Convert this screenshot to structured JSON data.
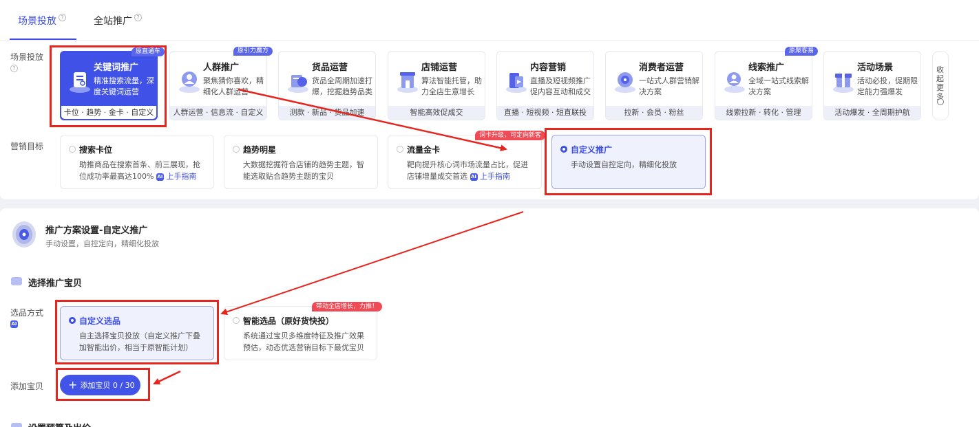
{
  "tabs": [
    {
      "label": "场景投放",
      "active": true
    },
    {
      "label": "全站推广",
      "active": false
    }
  ],
  "scene_row_label": "场景投放",
  "goal_row_label": "营销目标",
  "scene_cards": [
    {
      "title": "关键词推广",
      "desc": "精准搜索流量，深度关键词运营",
      "footer": "卡位 · 趋势 · 金卡 · 自定义",
      "badge": "原直通车",
      "selected": true
    },
    {
      "title": "人群推广",
      "desc": "聚焦猜你喜欢，精细化人群运营",
      "footer": "人群运营 · 信息流 · 自定义",
      "badge": "原引力魔方"
    },
    {
      "title": "货品运营",
      "desc": "货品全周期加速打爆，挖掘趋势品类",
      "footer": "测款 · 新品 · 货品加速"
    },
    {
      "title": "店铺运营",
      "desc": "算法智能托管，助力全店生意增长",
      "footer": "智能高效促成交"
    },
    {
      "title": "内容营销",
      "desc": "直播及短视频推广促内容互动和成交",
      "footer": "直播 · 短视频 · 短直联投"
    },
    {
      "title": "消费者运营",
      "desc": "一站式人群营销解决方案",
      "footer": "拉新 · 会员 · 粉丝"
    },
    {
      "title": "线索推广",
      "desc": "全域一站式线索解决方案",
      "footer": "线索拉新 · 转化 · 管理",
      "badge": "原聚客易"
    },
    {
      "title": "活动场景",
      "desc": "活动必投，促期限定能力强爆发",
      "footer": "活动爆发 · 全周期护航"
    }
  ],
  "collapse_label": "收起更多",
  "goal_cards": [
    {
      "title": "搜索卡位",
      "desc": "助推商品在搜索首条、前三展现，抢位成功率最高达100%",
      "link": "上手指南"
    },
    {
      "title": "趋势明星",
      "desc": "大数据挖掘符合店铺的趋势主题，智能选取贴合趋势主题的宝贝"
    },
    {
      "title": "流量金卡",
      "desc": "靶向提升核心词市场流量占比，促进店铺增量成交首选",
      "link": "上手指南"
    },
    {
      "title": "自定义推广",
      "desc": "手动设置自控定向，精细化投放",
      "selected": true
    }
  ],
  "goal_card_badge": "词卡升级，可定向新客",
  "ai_label": "AI",
  "plan": {
    "title": "推广方案设置-自定义推广",
    "subtitle": "手动设置，自控定向，精细化投放"
  },
  "select_section": {
    "title": "选择推广宝贝",
    "method_label": "选品方式",
    "options": [
      {
        "title": "自定义选品",
        "desc": "自主选择宝贝投放（自定义推广下叠加智能出价，相当于原智能计划）",
        "selected": true
      },
      {
        "title": "智能选品（原好货快投）",
        "desc": "系统通过宝贝多维度特征及推广效果预估，动态优选营销目标下最优宝贝"
      }
    ],
    "option_badge": "带动全店增长，力推！",
    "add_label": "添加宝贝",
    "add_button": "添加宝贝 0 / 30"
  },
  "next_section_title": "设置预算及出价",
  "colors": {
    "accent": "#3d4ee6",
    "annotation": "#e5261e",
    "badge_red": "#ef4a55"
  }
}
